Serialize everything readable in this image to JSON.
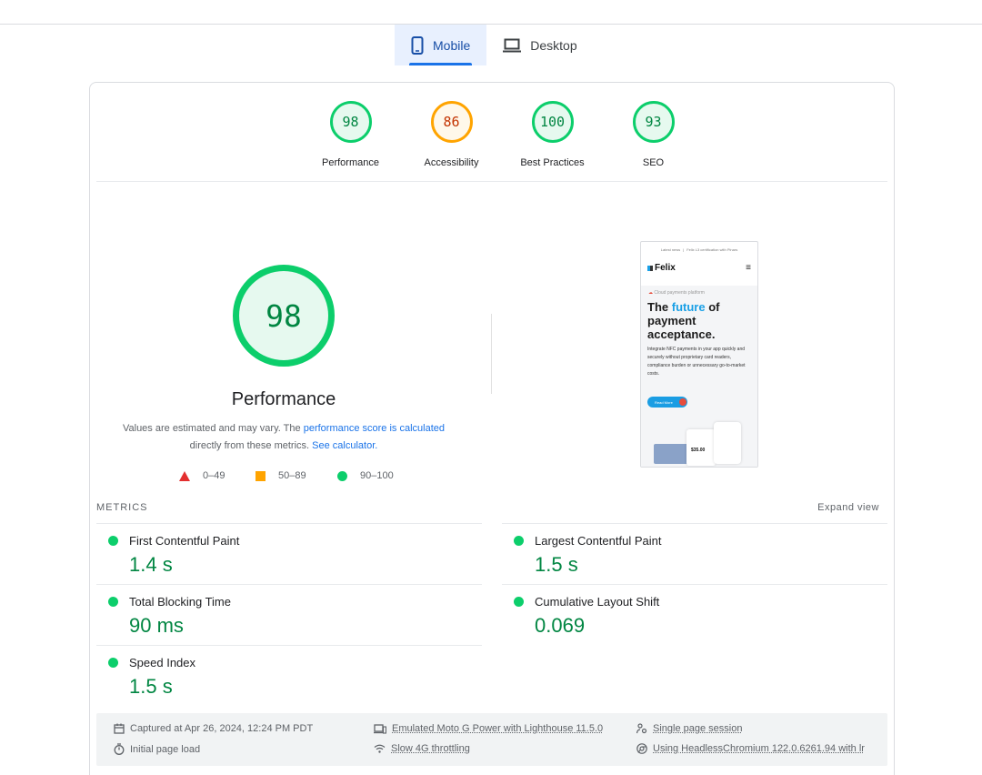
{
  "tabs": [
    {
      "label": "Mobile",
      "icon": "smartphone-icon",
      "active": true
    },
    {
      "label": "Desktop",
      "icon": "laptop-icon",
      "active": false
    }
  ],
  "category_scores": [
    {
      "score": "98",
      "label": "Performance",
      "status": "pass"
    },
    {
      "score": "86",
      "label": "Accessibility",
      "status": "average"
    },
    {
      "score": "100",
      "label": "Best Practices",
      "status": "pass"
    },
    {
      "score": "93",
      "label": "SEO",
      "status": "pass"
    }
  ],
  "performance": {
    "score": "98",
    "title": "Performance",
    "desc_prefix": "Values are estimated and may vary. The ",
    "desc_link1": "performance score is calculated",
    "desc_middle": "directly from these metrics. ",
    "desc_link2": "See calculator."
  },
  "legend": [
    {
      "range": "0–49",
      "color": "#e32f2f",
      "shape": "triangle"
    },
    {
      "range": "50–89",
      "color": "#ffa400",
      "shape": "square"
    },
    {
      "range": "90–100",
      "color": "#0cce6b",
      "shape": "circle"
    }
  ],
  "screenshot": {
    "topbar_left": "Latest news",
    "topbar_right": "Felix L3 certification with Pinars",
    "logo": "Felix",
    "kicker": "Cloud payments platform",
    "headline_pre": "The ",
    "headline_highlight": "future",
    "headline_post": " of payment acceptance.",
    "body": "Integrate NFC payments in your app quickly and securely without proprietary card readers, compliance burden or unnecessary go-to-market costs.",
    "cta": "Read More",
    "price": "$35.00"
  },
  "metrics": {
    "heading": "METRICS",
    "expand": "Expand view",
    "items": [
      {
        "name": "First Contentful Paint",
        "value": "1.4 s",
        "status": "pass"
      },
      {
        "name": "Largest Contentful Paint",
        "value": "1.5 s",
        "status": "pass"
      },
      {
        "name": "Total Blocking Time",
        "value": "90 ms",
        "status": "pass"
      },
      {
        "name": "Cumulative Layout Shift",
        "value": "0.069",
        "status": "pass"
      },
      {
        "name": "Speed Index",
        "value": "1.5 s",
        "status": "pass"
      }
    ]
  },
  "footer": {
    "captured": "Captured at Apr 26, 2024, 12:24 PM PDT",
    "initial": "Initial page load",
    "emulated": "Emulated Moto G Power with Lighthouse 11.5.0",
    "throttling": "Slow 4G throttling",
    "session": "Single page session",
    "browser": "Using HeadlessChromium 122.0.6261.94 with lr"
  },
  "colors": {
    "pass": "#0cce6b",
    "average": "#ffa400",
    "fail": "#e32f2f",
    "link": "#1a73e8"
  }
}
